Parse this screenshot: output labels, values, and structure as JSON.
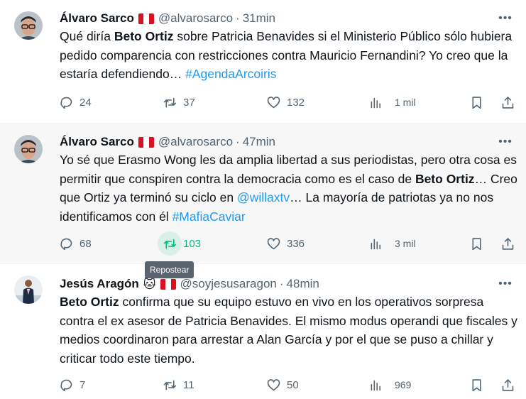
{
  "tweets": [
    {
      "name": "Álvaro Sarco",
      "handle": "@alvarosarco",
      "time": "31min",
      "text": [
        {
          "t": "Qué diría "
        },
        {
          "t": "Beto Ortiz",
          "b": true
        },
        {
          "t": " sobre Patricia Benavides si el Ministerio Público sólo hubiera pedido comparencia con restricciones contra Mauricio Fernandini? Yo creo que la estaría defendiendo… "
        },
        {
          "t": "#AgendaArcoiris",
          "link": true
        }
      ],
      "stats": {
        "replies": "24",
        "reposts": "37",
        "likes": "132",
        "views": "1 mil"
      }
    },
    {
      "name": "Álvaro Sarco",
      "handle": "@alvarosarco",
      "time": "47min",
      "text": [
        {
          "t": "Yo sé que Erasmo Wong les da amplia libertad a sus periodistas, pero otra cosa es permitir que conspiren contra la democracia como es el caso de "
        },
        {
          "t": "Beto Ortiz",
          "b": true
        },
        {
          "t": "… Creo que Ortiz ya terminó su ciclo en "
        },
        {
          "t": "@willaxtv",
          "link": true
        },
        {
          "t": "… La mayoría de patriotas ya no nos identificamos con él "
        },
        {
          "t": "#MafiaCaviar",
          "link": true
        }
      ],
      "stats": {
        "replies": "68",
        "reposts": "103",
        "likes": "336",
        "views": "3 mil"
      }
    },
    {
      "name": "Jesús Aragón",
      "handle": "@soyjesusaragon",
      "time": "48min",
      "text": [
        {
          "t": "Beto Ortiz",
          "b": true
        },
        {
          "t": " confirma que su equipo estuvo en vivo en los operativos sorpresa contra el ex asesor de Patricia Benavides. El mismo modus operandi que fiscales y medios coordinaron para arrestar a Alan García y por el que se puso a chillar y criticar todo este tiempo."
        }
      ],
      "stats": {
        "replies": "7",
        "reposts": "11",
        "likes": "50",
        "views": "969"
      }
    }
  ],
  "tooltip": "Repostear",
  "icons": {
    "more": "more-horizontal-icon",
    "reply": "reply-icon",
    "repost": "repost-icon",
    "like": "heart-icon",
    "views": "views-chart-icon",
    "bookmark": "bookmark-icon",
    "share": "share-icon",
    "flag": "peru-flag-icon",
    "emoji": "cat-face-emoji"
  },
  "colors": {
    "link": "#1d9bf0",
    "repost_hover": "#00ba7c",
    "muted": "#536471",
    "tooltip_bg": "#5a646e"
  }
}
